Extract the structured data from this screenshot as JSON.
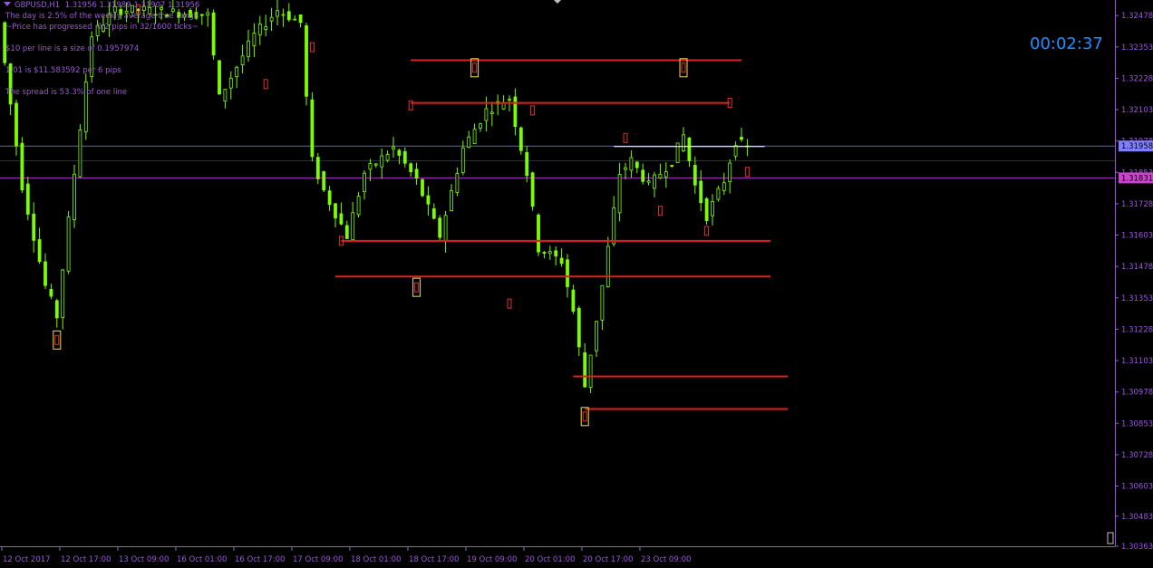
{
  "header": {
    "symbol_line": "GBPUSD,H1  1.31956 1.31989 1.31907 1.31956",
    "line1": "The day is 2.5% of the weekly average true range",
    "line2": "~Price has progressed  0.2 pips in 32/1600 ticks~",
    "line3": "$10 per line is a size of 0.1957974",
    "line4": "1.01 is $11.583592 per 6 pips",
    "line5": "The spread is 53.3% of one line"
  },
  "timer": "00:02:37",
  "colors": {
    "background": "#000000",
    "candle": "#7cfc00",
    "axis_text": "#9a56e0",
    "level_line": "#e02020",
    "bid_line": "#3b3bd8",
    "marker_outer": "#f0e040",
    "marker_inner": "#e03030"
  },
  "chart_data": {
    "type": "candlestick",
    "symbol": "GBPUSD",
    "timeframe": "H1",
    "ylim": [
      1.30363,
      1.3254
    ],
    "y_ticks": [
      "1.32478",
      "1.32353",
      "1.32228",
      "1.32103",
      "1.31978",
      "1.31853",
      "1.31728",
      "1.31603",
      "1.31478",
      "1.31353",
      "1.31228",
      "1.31103",
      "1.30978",
      "1.30853",
      "1.30728",
      "1.30603",
      "1.30483",
      "1.30363"
    ],
    "x_ticks": [
      "12 Oct 2017",
      "12 Oct 17:00",
      "13 Oct 09:00",
      "16 Oct 01:00",
      "16 Oct 17:00",
      "17 Oct 09:00",
      "18 Oct 01:00",
      "18 Oct 17:00",
      "19 Oct 09:00",
      "20 Oct 01:00",
      "20 Oct 17:00",
      "23 Oct 09:00"
    ],
    "bar_count": 190,
    "price_labels": [
      {
        "price": 1.31958,
        "text": "1.31958",
        "color": "#8080ff"
      },
      {
        "price": 1.31831,
        "text": "1.31831",
        "color": "#cc44cc"
      }
    ],
    "horizontal_lines": [
      {
        "price": 1.31899,
        "color": "#2020a0"
      },
      {
        "price": 1.31958,
        "color": "#6060c0"
      },
      {
        "price": 1.31831,
        "color": "#b030d0"
      }
    ],
    "support_resistance": [
      {
        "price": 1.323,
        "from_bar": 70,
        "to_bar": 127
      },
      {
        "price": 1.3213,
        "from_bar": 70,
        "to_bar": 125
      },
      {
        "price": 1.3158,
        "from_bar": 58,
        "to_bar": 132
      },
      {
        "price": 1.31438,
        "from_bar": 57,
        "to_bar": 132
      },
      {
        "price": 1.3104,
        "from_bar": 98,
        "to_bar": 135
      },
      {
        "price": 1.3091,
        "from_bar": 100,
        "to_bar": 135
      }
    ],
    "current_price_line": {
      "price": 1.31956,
      "from_bar": 105,
      "to_bar": 131
    },
    "swing_markers": [
      {
        "bar": 9,
        "price": 1.31185,
        "strong": true
      },
      {
        "bar": 23,
        "price": 1.32503,
        "strong": false
      },
      {
        "bar": 45,
        "price": 1.32205,
        "strong": false
      },
      {
        "bar": 53,
        "price": 1.32352,
        "strong": false
      },
      {
        "bar": 58,
        "price": 1.3158,
        "strong": false
      },
      {
        "bar": 70,
        "price": 1.3212,
        "strong": false
      },
      {
        "bar": 71,
        "price": 1.31395,
        "strong": true
      },
      {
        "bar": 81,
        "price": 1.3227,
        "strong": true
      },
      {
        "bar": 87,
        "price": 1.3133,
        "strong": false
      },
      {
        "bar": 91,
        "price": 1.321,
        "strong": false
      },
      {
        "bar": 100,
        "price": 1.3088,
        "strong": true
      },
      {
        "bar": 107,
        "price": 1.3199,
        "strong": false
      },
      {
        "bar": 113,
        "price": 1.317,
        "strong": false
      },
      {
        "bar": 117,
        "price": 1.3227,
        "strong": true
      },
      {
        "bar": 121,
        "price": 1.3162,
        "strong": false
      },
      {
        "bar": 125,
        "price": 1.3213,
        "strong": false
      },
      {
        "bar": 128,
        "price": 1.31855,
        "strong": false
      }
    ]
  }
}
